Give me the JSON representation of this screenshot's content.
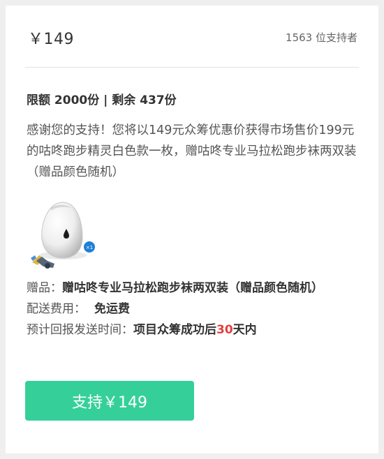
{
  "header": {
    "price": "￥149",
    "backers": "1563 位支持者"
  },
  "limit": {
    "text": "限额 2000份 | 剩余 437份"
  },
  "description": "感谢您的支持！您将以149元众筹优惠价获得市场售价199元的咕咚跑步精灵白色款一枚，赠咕咚专业马拉松跑步袜两双装（赠品颜色随机）",
  "product_image": {
    "badge": "×1"
  },
  "reward": {
    "gift_label": "赠品：",
    "gift_value": "赠咕咚专业马拉松跑步袜两双装（赠品颜色随机）",
    "shipping_label": "配送费用：",
    "shipping_value": "免运费",
    "delivery_label": "预计回报发送时间：",
    "delivery_prefix": "项目众筹成功后",
    "delivery_days": "30",
    "delivery_suffix": "天内"
  },
  "button": {
    "label": "支持￥149"
  },
  "colors": {
    "accent": "#35d09a",
    "highlight": "#e24040",
    "badge": "#1e7fd6"
  }
}
